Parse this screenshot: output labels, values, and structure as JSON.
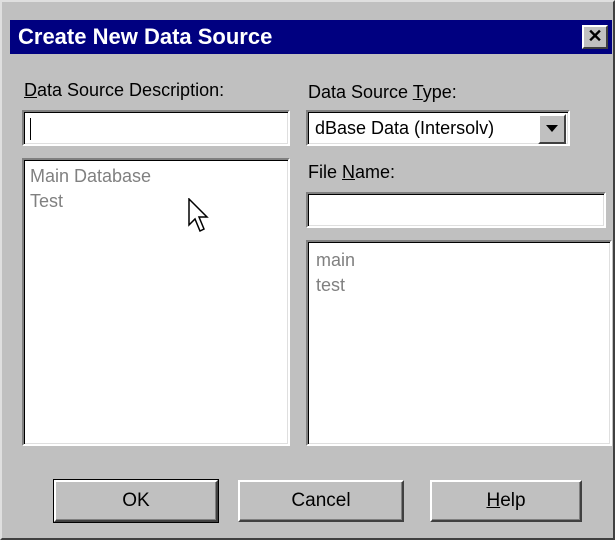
{
  "dialog": {
    "title": "Create New Data Source",
    "close_glyph": "✕"
  },
  "description": {
    "label_mnemonic": "D",
    "label_rest": "ata Source Description:",
    "value": "",
    "items": [
      "Main Database",
      "Test"
    ]
  },
  "type": {
    "label_prefix": "Data Source ",
    "label_mnemonic": "T",
    "label_rest": "ype:",
    "selected": "dBase Data (Intersolv)"
  },
  "file": {
    "label_prefix": "File ",
    "label_mnemonic": "N",
    "label_rest": "ame:",
    "value": "",
    "items": [
      "main",
      "test"
    ]
  },
  "buttons": {
    "ok": "OK",
    "cancel": "Cancel",
    "help_mnemonic": "H",
    "help_rest": "elp"
  },
  "icons": {
    "close": "close-icon",
    "dropdown": "chevron-down-icon",
    "cursor": "mouse-pointer-icon"
  },
  "colors": {
    "titlebar": "#000080",
    "face": "#c0c0c0",
    "disabled_text": "#808080"
  }
}
